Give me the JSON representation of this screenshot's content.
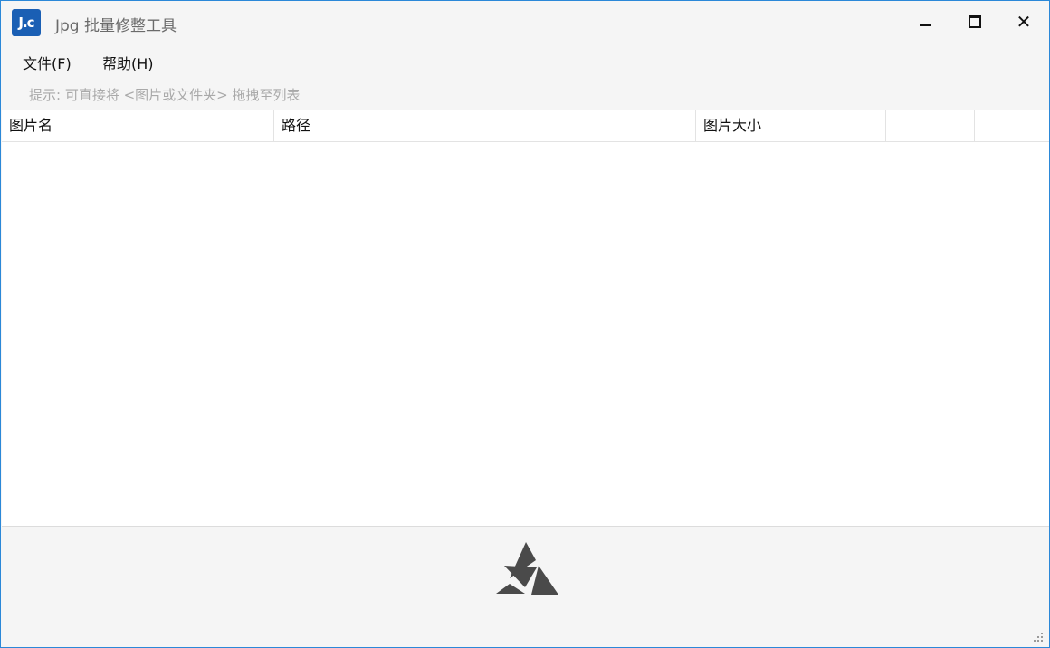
{
  "window": {
    "title": "Jpg 批量修整工具",
    "icon": "app-logo-icon",
    "icon_text": "J.c"
  },
  "menu": {
    "items": [
      {
        "label": "文件(F)"
      },
      {
        "label": "帮助(H)"
      }
    ]
  },
  "hint": "提示: 可直接将 <图片或文件夹> 拖拽至列表",
  "list": {
    "columns": [
      {
        "label": "图片名"
      },
      {
        "label": "路径"
      },
      {
        "label": "图片大小"
      },
      {
        "label": ""
      },
      {
        "label": ""
      }
    ],
    "rows": []
  },
  "footer": {
    "logo": "triangle-logo-icon"
  },
  "colors": {
    "border_accent": "#2b88d8",
    "app_icon_bg": "#1a5fb4",
    "hint_text": "#a9a9a9",
    "logo": "#4a4a4a"
  }
}
